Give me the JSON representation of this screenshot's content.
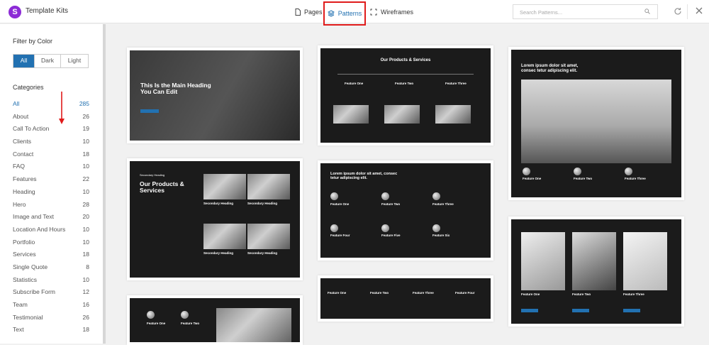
{
  "header": {
    "logo_glyph": "S",
    "app_title": "Template Kits",
    "tabs": [
      {
        "label": "Pages",
        "icon": "document-icon"
      },
      {
        "label": "Patterns",
        "icon": "layers-icon",
        "active": true
      },
      {
        "label": "Wireframes",
        "icon": "frame-icon"
      }
    ],
    "search_placeholder": "Search Patterns..."
  },
  "sidebar": {
    "filter_label": "Filter by Color",
    "color_options": [
      "All",
      "Dark",
      "Light"
    ],
    "selected_color": "All",
    "categories_title": "Categories",
    "categories": [
      {
        "name": "All",
        "count": "285"
      },
      {
        "name": "About",
        "count": "26"
      },
      {
        "name": "Call To Action",
        "count": "19"
      },
      {
        "name": "Clients",
        "count": "10"
      },
      {
        "name": "Contact",
        "count": "18"
      },
      {
        "name": "FAQ",
        "count": "10"
      },
      {
        "name": "Features",
        "count": "22"
      },
      {
        "name": "Heading",
        "count": "10"
      },
      {
        "name": "Hero",
        "count": "28"
      },
      {
        "name": "Image and Text",
        "count": "20"
      },
      {
        "name": "Location And Hours",
        "count": "10"
      },
      {
        "name": "Portfolio",
        "count": "10"
      },
      {
        "name": "Services",
        "count": "18"
      },
      {
        "name": "Single Quote",
        "count": "8"
      },
      {
        "name": "Statistics",
        "count": "10"
      },
      {
        "name": "Subscribe Form",
        "count": "12"
      },
      {
        "name": "Team",
        "count": "16"
      },
      {
        "name": "Testimonial",
        "count": "26"
      },
      {
        "name": "Text",
        "count": "18"
      }
    ]
  },
  "patterns": {
    "hero_heading": "This Is the Main Heading You Can Edit",
    "products_title": "Our Products & Services",
    "secondary_label": "Secondary Heading",
    "secondary_heading": "Secondary Heading",
    "lorem_heading": "Lorem ipsum dolor sit amet, consec tetur adipiscing elit.",
    "features3": [
      "Feature One",
      "Feature Two",
      "Feature Three"
    ],
    "features6": [
      "Feature One",
      "Feature Two",
      "Feature Three",
      "Feature Four",
      "Feature Five",
      "Feature Six"
    ],
    "features4": [
      "Feature One",
      "Feature Two",
      "Feature Three",
      "Feature Four"
    ]
  },
  "colors": {
    "accent": "#2271b1",
    "brand": "#8c2bd6",
    "highlight": "#e01b1b",
    "thumb_bg": "#1b1b1b"
  }
}
